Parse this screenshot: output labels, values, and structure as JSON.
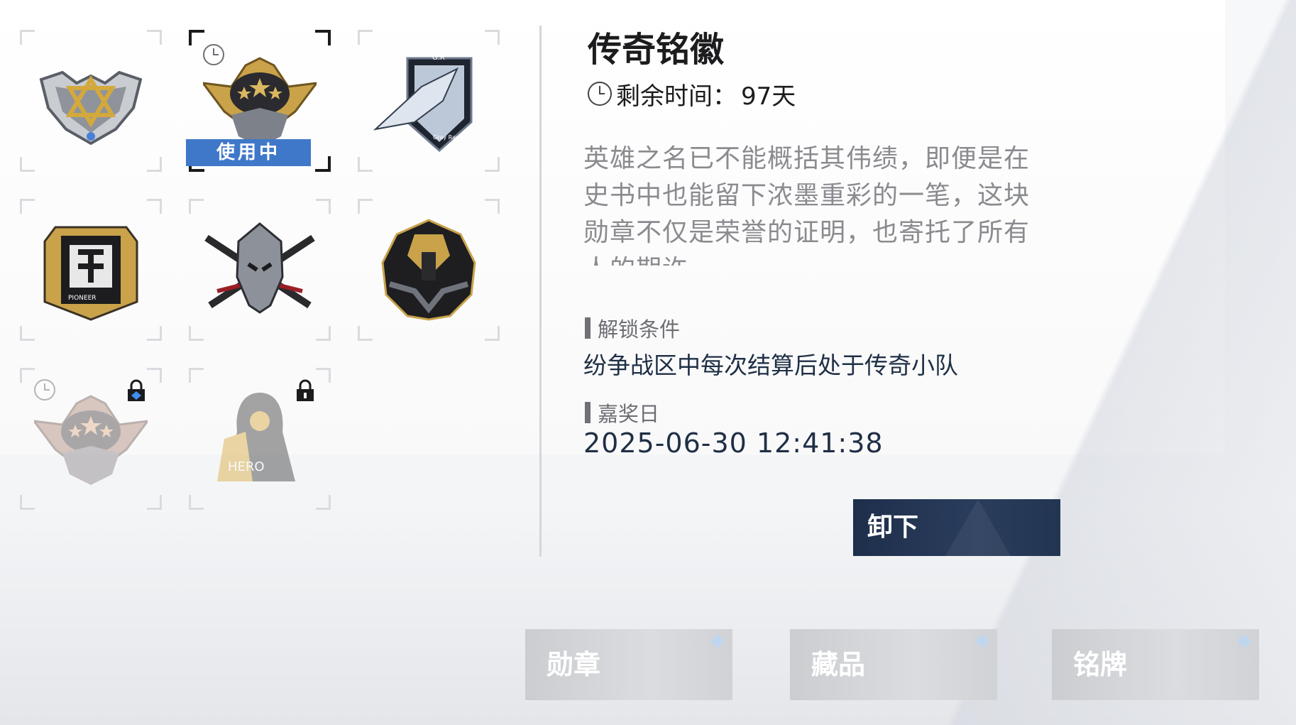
{
  "badges": [
    {
      "name": "badge-star-triangle",
      "state": "normal"
    },
    {
      "name": "badge-gold-stars",
      "state": "in-use",
      "timed": true
    },
    {
      "name": "badge-gray-raven-shield",
      "state": "normal"
    },
    {
      "name": "badge-pioneer-plate",
      "state": "normal"
    },
    {
      "name": "badge-crossed-blades-helm",
      "state": "normal"
    },
    {
      "name": "badge-dark-gold-crest",
      "state": "normal"
    },
    {
      "name": "badge-gold-stars-locked",
      "state": "locked",
      "timed": true
    },
    {
      "name": "badge-hooded-figure-locked",
      "state": "locked"
    }
  ],
  "in_use_label": "使用中",
  "badge_icon_texts": {
    "gray_raven_top": "G.R",
    "gray_raven_bottom": "Gray RaveN",
    "pioneer": "PIONEER",
    "hooded": "HERO"
  },
  "detail": {
    "title": "传奇铭徽",
    "remaining_label": "剩余时间：",
    "remaining_value": "97天",
    "description": "英雄之名已不能概括其伟绩，即便是在史书中也能留下浓墨重彩的一笔，这块勋章不仅是荣誉的证明，也寄托了所有人的期许",
    "unlock_heading": "解锁条件",
    "unlock_condition": "纷争战区中每次结算后处于传奇小队",
    "award_heading": "嘉奖日",
    "award_date": "2025-06-30 12:41:38",
    "unequip_label": "卸下"
  },
  "tabs": [
    {
      "label": "勋章"
    },
    {
      "label": "藏品"
    },
    {
      "label": "铭牌"
    }
  ],
  "colors": {
    "in_use_bg": "#3f78c9",
    "button_bg": "#1e2f4c",
    "accent_gold": "#c9a24a",
    "text_dark": "#1c1c1e",
    "text_gray": "#8a8b8f"
  }
}
